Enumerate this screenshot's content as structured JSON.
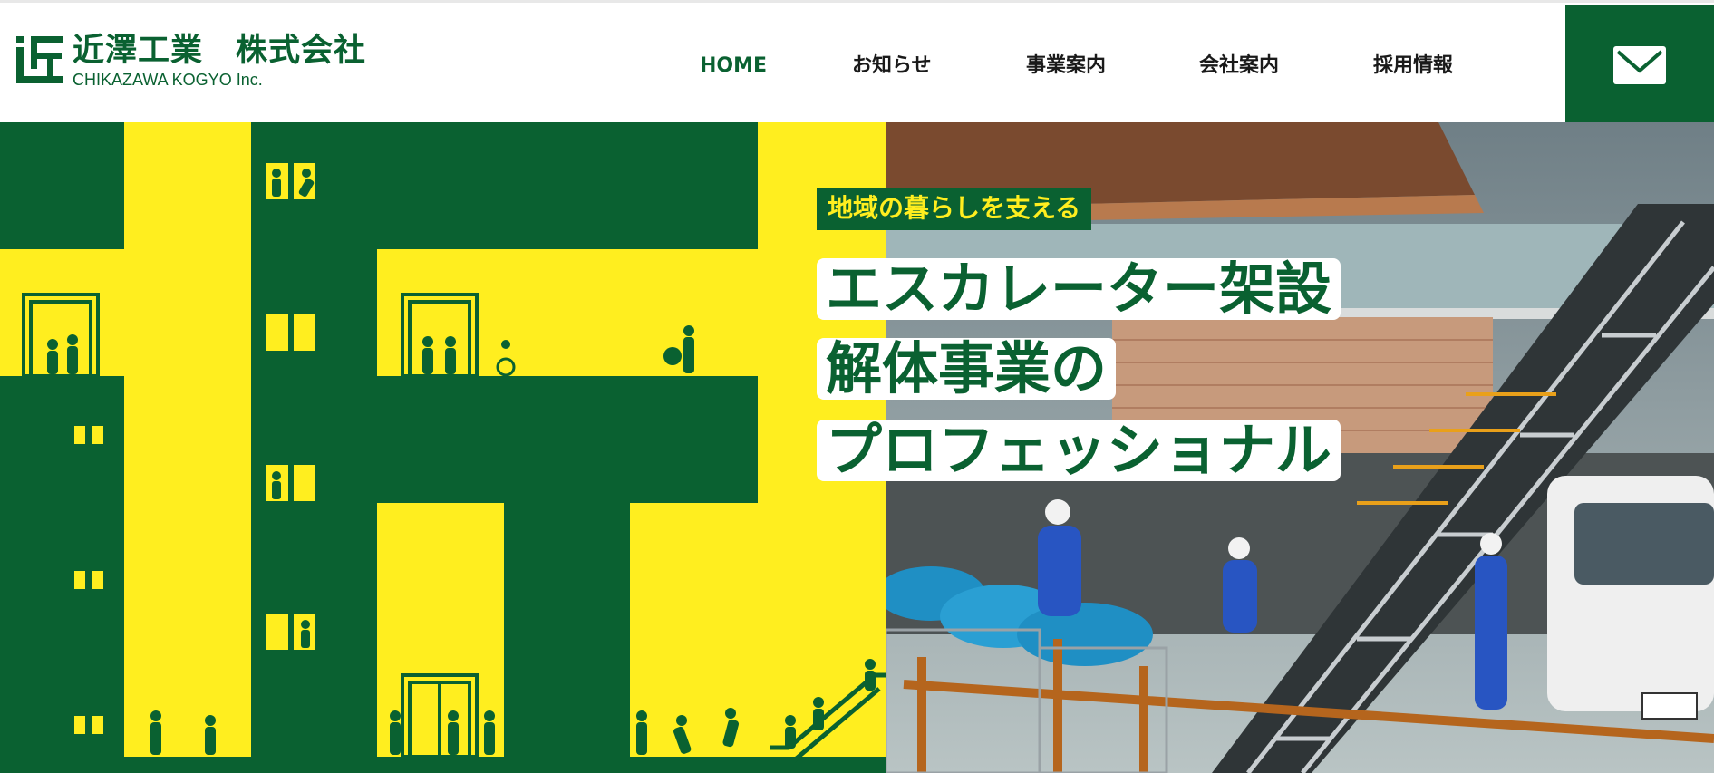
{
  "brand": {
    "name_jp": "近澤工業　株式会社",
    "name_en": "CHIKAZAWA KOGYO Inc."
  },
  "nav": {
    "items": [
      {
        "label": "HOME",
        "active": true
      },
      {
        "label": "お知らせ",
        "active": false
      },
      {
        "label": "事業案内",
        "active": false
      },
      {
        "label": "会社案内",
        "active": false
      },
      {
        "label": "採用情報",
        "active": false
      }
    ]
  },
  "contact": {
    "icon": "mail-icon"
  },
  "hero": {
    "tagline": "地域の暮らしを支える",
    "headline": [
      "エスカレーター架設",
      "解体事業の",
      "プロフェッショナル"
    ]
  },
  "colors": {
    "brand_green": "#0a6131",
    "brand_yellow": "#ffee1f",
    "text_dark": "#1a1a1a"
  }
}
